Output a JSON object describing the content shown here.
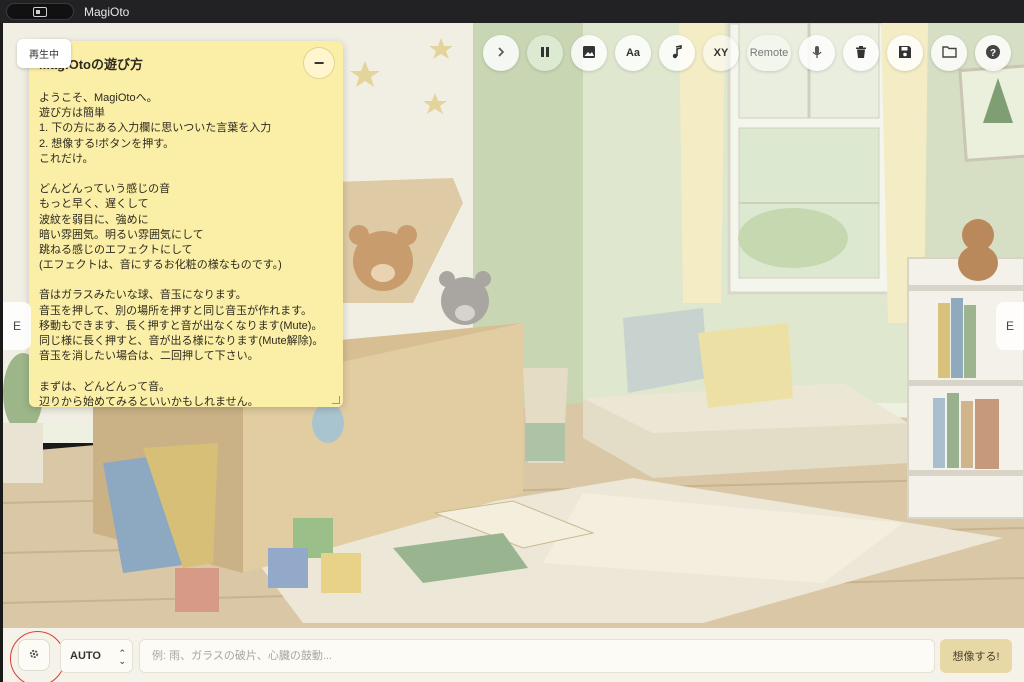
{
  "window": {
    "title": "MagiOto"
  },
  "status_badge": "再生中",
  "toolbar": {
    "items": [
      {
        "name": "next",
        "icon": "chevron-right-icon",
        "label": ""
      },
      {
        "name": "pause",
        "icon": "pause-icon",
        "label": ""
      },
      {
        "name": "image",
        "icon": "image-icon",
        "label": ""
      },
      {
        "name": "text",
        "icon": "text-icon",
        "label": "Aa"
      },
      {
        "name": "music",
        "icon": "music-note-icon",
        "label": ""
      },
      {
        "name": "xy",
        "icon": "",
        "label": "XY"
      },
      {
        "name": "remote",
        "icon": "",
        "label": "Remote"
      },
      {
        "name": "mic",
        "icon": "microphone-icon",
        "label": ""
      },
      {
        "name": "trash",
        "icon": "trash-icon",
        "label": ""
      },
      {
        "name": "save",
        "icon": "save-icon",
        "label": ""
      },
      {
        "name": "folder",
        "icon": "folder-icon",
        "label": ""
      },
      {
        "name": "help",
        "icon": "help-icon",
        "label": ""
      }
    ]
  },
  "help_panel": {
    "title": "MagiOtoの遊び方",
    "minimize_label": "−",
    "lines": [
      "ようこそ、MagiOtoへ。",
      "遊び方は簡単",
      "1. 下の方にある入力欄に思いついた言葉を入力",
      "2. 想像する!ボタンを押す。",
      "これだけ。",
      "",
      "どんどんっていう感じの音",
      "もっと早く、遅くして",
      "波紋を弱目に、強めに",
      "暗い雰囲気。明るい雰囲気にして",
      "跳ねる感じのエフェクトにして",
      "(エフェクトは、音にするお化粧の様なものです。)",
      "",
      "音はガラスみたいな球、音玉になります。",
      "音玉を押して、別の場所を押すと同じ音玉が作れます。",
      "移動もできます、長く押すと音が出なくなります(Mute)。",
      "同じ様に長く押すと、音が出る様になります(Mute解除)。",
      "音玉を消したい場合は、二回押して下さい。",
      "",
      "まずは、どんどんって音。",
      "辺りから始めてみるといいかもしれません。"
    ]
  },
  "edge_tabs": {
    "left": "E",
    "right": "E"
  },
  "bottom_bar": {
    "settings_icon": "gear-icon",
    "mode_select": {
      "selected": "AUTO"
    },
    "prompt": {
      "value": "",
      "placeholder": "例: 雨、ガラスの破片、心臓の鼓動..."
    },
    "imagine_button": "想像する!"
  }
}
